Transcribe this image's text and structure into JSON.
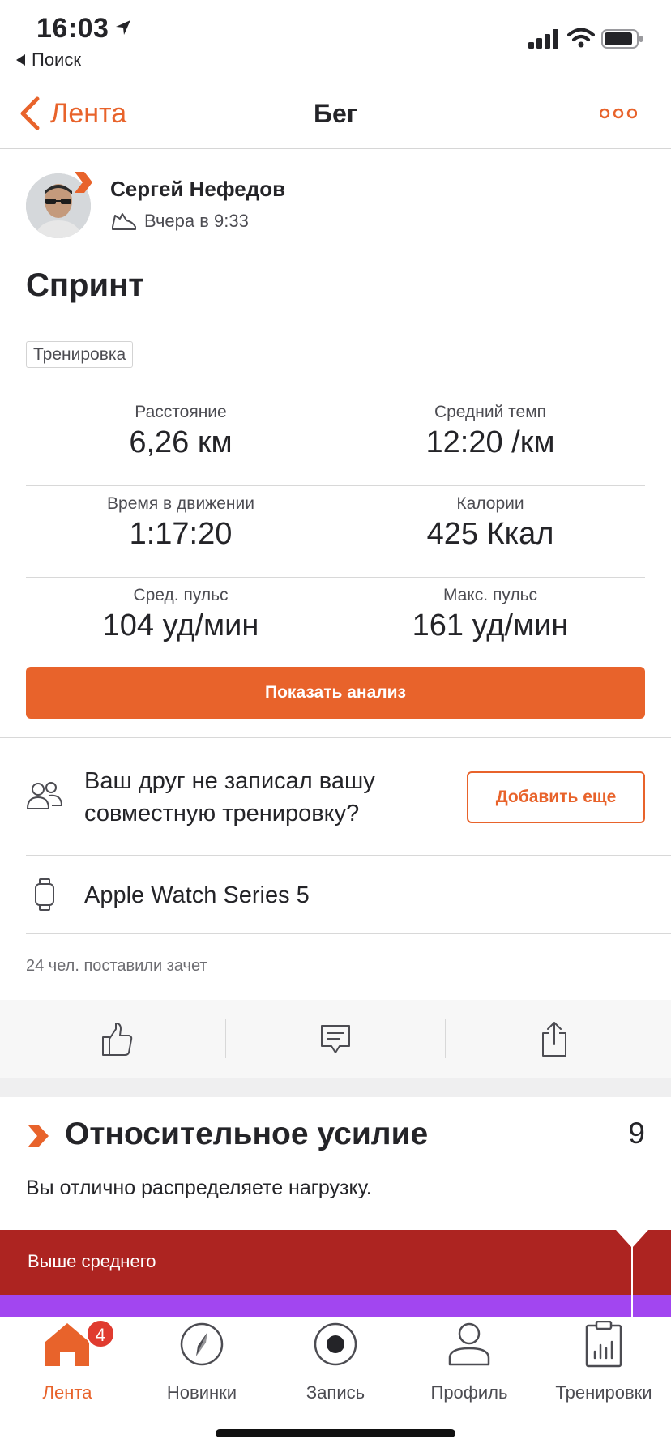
{
  "status_bar": {
    "time": "16:03",
    "back_app": "Поиск"
  },
  "nav": {
    "back_label": "Лента",
    "title": "Бег"
  },
  "activity": {
    "athlete_name": "Сергей Нефедов",
    "timestamp": "Вчера в 9:33",
    "title": "Спринт",
    "tag": "Тренировка"
  },
  "stats": [
    {
      "left": {
        "label": "Расстояние",
        "value": "6,26 км"
      },
      "right": {
        "label": "Средний темп",
        "value": "12:20 /км"
      }
    },
    {
      "left": {
        "label": "Время в движении",
        "value": "1:17:20"
      },
      "right": {
        "label": "Калории",
        "value": "425 Ккал"
      }
    },
    {
      "left": {
        "label": "Сред. пульс",
        "value": "104 уд/мин"
      },
      "right": {
        "label": "Макс. пульс",
        "value": "161 уд/мин"
      }
    }
  ],
  "analysis_button": "Показать анализ",
  "friends": {
    "text": "Ваш друг не записал вашу совместную тренировку?",
    "button": "Добавить еще"
  },
  "device": {
    "name": "Apple Watch Series 5"
  },
  "kudos_text": "24 чел. поставили зачет",
  "relative_effort": {
    "title": "Относительное усилие",
    "score": "9",
    "description": "Вы отлично распределяете нагрузку.",
    "level_label": "Выше среднего"
  },
  "tabs": [
    {
      "label": "Лента",
      "badge": "4",
      "icon": "home-icon"
    },
    {
      "label": "Новинки",
      "icon": "compass-icon"
    },
    {
      "label": "Запись",
      "icon": "record-icon"
    },
    {
      "label": "Профиль",
      "icon": "profile-icon"
    },
    {
      "label": "Тренировки",
      "icon": "clipboard-chart-icon"
    }
  ],
  "colors": {
    "accent": "#e8632b",
    "effort_red": "#ad2421",
    "effort_purple": "#a246f0",
    "badge_red": "#e03b2f"
  }
}
